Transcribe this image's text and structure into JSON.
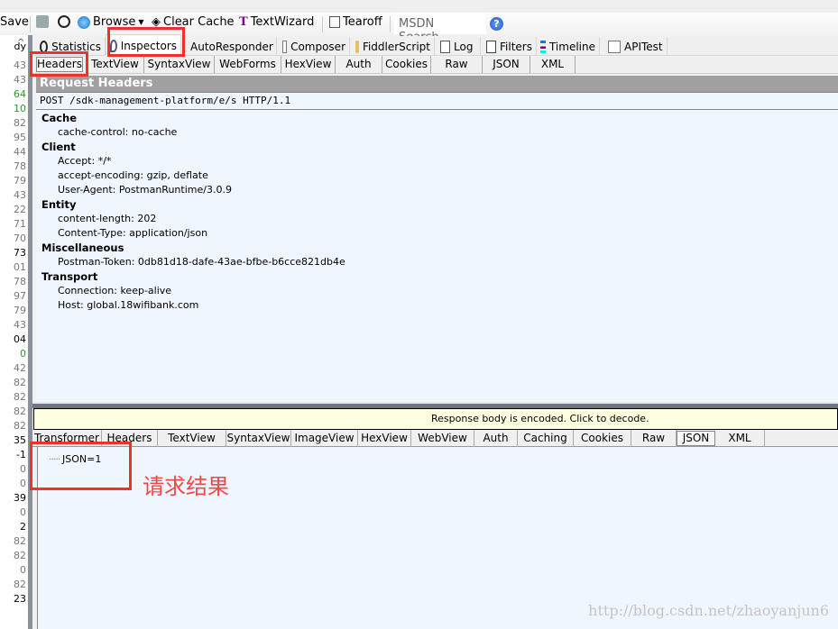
{
  "toolbar": {
    "save": "Save",
    "browse": "Browse",
    "clear_cache": "Clear Cache",
    "textwizard": "TextWizard",
    "tearoff": "Tearoff",
    "msdn_search_placeholder": "MSDN Search...",
    "help": "?"
  },
  "session_list": {
    "header": "dy",
    "values": [
      "43",
      "43",
      "64",
      "10",
      "82",
      "95",
      "44",
      "78",
      "79",
      "43",
      "22",
      "71",
      "70",
      "73",
      "01",
      "78",
      "97",
      "79",
      "43",
      "04",
      "0",
      "42",
      "82",
      "82",
      "82",
      "82",
      "35",
      "-1",
      "0",
      "0",
      "39",
      "0",
      "2",
      "82",
      "82",
      "0",
      "82",
      "23"
    ]
  },
  "main_tabs": [
    {
      "label": "Statistics",
      "icon": "stopwatch-icon"
    },
    {
      "label": "Inspectors",
      "icon": "magnifier-icon",
      "selected": true
    },
    {
      "label": "AutoResponder",
      "icon": "lightning-icon"
    },
    {
      "label": "Composer",
      "icon": "pencil-icon"
    },
    {
      "label": "FiddlerScript",
      "icon": "script-icon"
    },
    {
      "label": "Log",
      "icon": "log-icon"
    },
    {
      "label": "Filters",
      "icon": "checkbox-icon"
    },
    {
      "label": "Timeline",
      "icon": "timeline-icon"
    },
    {
      "label": "APITest",
      "icon": "pencil-icon"
    }
  ],
  "request_tabs": [
    "Headers",
    "TextView",
    "SyntaxView",
    "WebForms",
    "HexView",
    "Auth",
    "Cookies",
    "Raw",
    "JSON",
    "XML"
  ],
  "request": {
    "title": "Request Headers",
    "line": "POST /sdk-management-platform/e/s HTTP/1.1",
    "groups": [
      {
        "name": "Cache",
        "items": [
          "cache-control: no-cache"
        ]
      },
      {
        "name": "Client",
        "items": [
          "Accept: */*",
          "accept-encoding: gzip, deflate",
          "User-Agent: PostmanRuntime/3.0.9"
        ]
      },
      {
        "name": "Entity",
        "items": [
          "content-length: 202",
          "Content-Type: application/json"
        ]
      },
      {
        "name": "Miscellaneous",
        "items": [
          "Postman-Token: 0db81d18-dafe-43ae-bfbe-b6cce821db4e"
        ]
      },
      {
        "name": "Transport",
        "items": [
          "Connection: keep-alive",
          "Host: global.18wifibank.com"
        ]
      }
    ]
  },
  "response": {
    "notice": "Response body is encoded. Click to decode.",
    "tabs": [
      "Transformer",
      "Headers",
      "TextView",
      "SyntaxView",
      "ImageView",
      "HexView",
      "WebView",
      "Auth",
      "Caching",
      "Cookies",
      "Raw",
      "JSON",
      "XML"
    ],
    "selected_tab": "JSON",
    "tree_item": "JSON=1"
  },
  "annotation": "请求结果",
  "watermark": "http://blog.csdn.net/zhaoyanjun6",
  "colors": {
    "highlight_red": "#f03030",
    "panel_bg": "#f0f6fe",
    "notice_bg": "#ffffe1",
    "header_bar": "#a0a0a0"
  }
}
